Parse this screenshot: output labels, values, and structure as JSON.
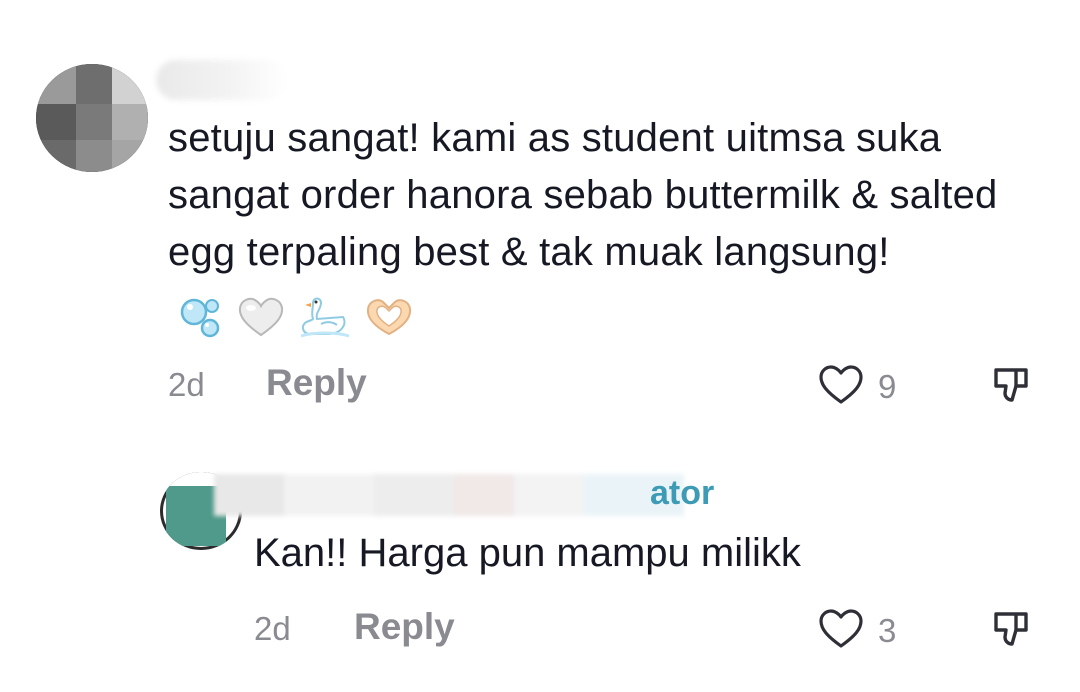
{
  "comment": {
    "username": "",
    "text": "setuju sangat! kami as student uitmsa suka sangat order hanora sebab buttermilk & salted egg terpaling best & tak muak langsung!",
    "emojis": [
      "bubbles-emoji",
      "white-heart-emoji",
      "swan-emoji",
      "heart-hands-emoji"
    ],
    "time": "2d",
    "reply_label": "Reply",
    "like_count": "9"
  },
  "reply": {
    "username_visible_suffix": "ator",
    "text": "Kan!! Harga pun mampu milikk",
    "time": "2d",
    "reply_label": "Reply",
    "like_count": "3"
  },
  "colors": {
    "text": "#161823",
    "muted": "#8a8b91",
    "creator_accent": "#3d9bb5",
    "icon": "#2f3037"
  }
}
